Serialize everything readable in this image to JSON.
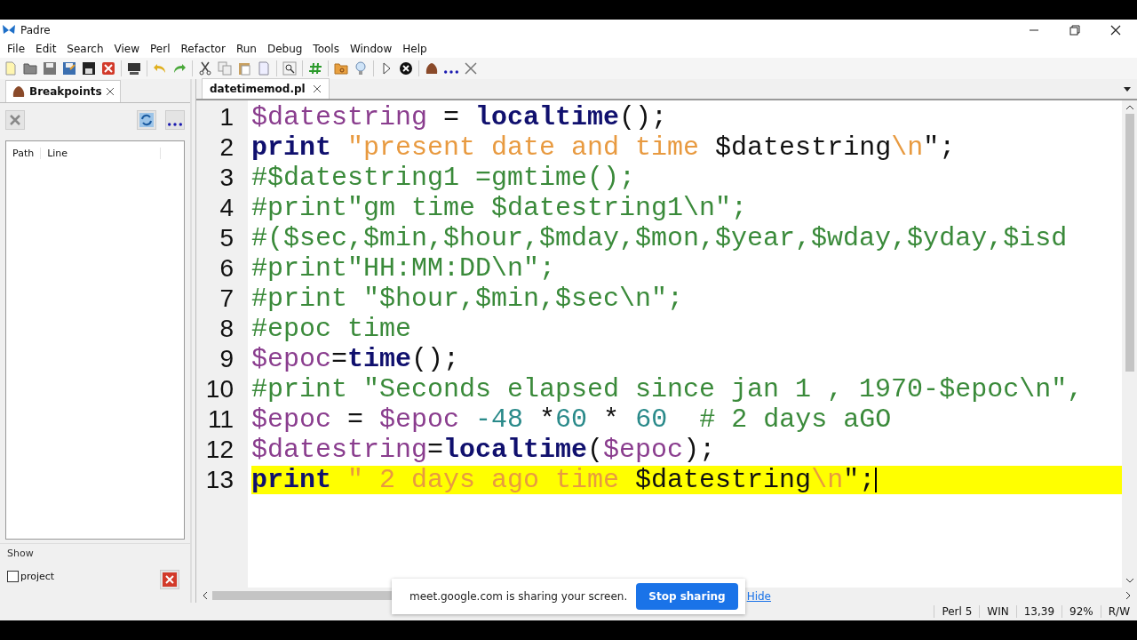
{
  "window": {
    "title": "Padre"
  },
  "menu": [
    "File",
    "Edit",
    "Search",
    "View",
    "Perl",
    "Refactor",
    "Run",
    "Debug",
    "Tools",
    "Window",
    "Help"
  ],
  "breakpoints_panel": {
    "tab": {
      "label": "Breakpoints",
      "selected": true
    },
    "columns": [
      "Path",
      "Line"
    ],
    "show_label": "Show",
    "project_checkbox": {
      "label": "project",
      "checked": false
    }
  },
  "editor": {
    "tabs": [
      {
        "label": "datetimemod.pl",
        "selected": true
      }
    ],
    "lines": [
      {
        "number": "1",
        "current": false,
        "tokens": [
          {
            "kind": "var",
            "text": "$datestring"
          },
          {
            "kind": "plain",
            "text": " = "
          },
          {
            "kind": "kw",
            "text": "localtime"
          },
          {
            "kind": "plain",
            "text": "();"
          }
        ]
      },
      {
        "number": "2",
        "current": false,
        "tokens": [
          {
            "kind": "kw",
            "text": "print "
          },
          {
            "kind": "str",
            "text": "\"present date and time "
          },
          {
            "kind": "plain",
            "text": "$datestring"
          },
          {
            "kind": "esc",
            "text": "\\n"
          },
          {
            "kind": "plain",
            "text": "\";"
          }
        ]
      },
      {
        "number": "3",
        "current": false,
        "tokens": [
          {
            "kind": "comment",
            "text": "#$datestring1 =gmtime();"
          }
        ]
      },
      {
        "number": "4",
        "current": false,
        "tokens": [
          {
            "kind": "comment",
            "text": "#print\"gm time $datestring1\\n\";"
          }
        ]
      },
      {
        "number": "5",
        "current": false,
        "tokens": [
          {
            "kind": "comment",
            "text": "#($sec,$min,$hour,$mday,$mon,$year,$wday,$yday,$isd"
          }
        ]
      },
      {
        "number": "6",
        "current": false,
        "tokens": [
          {
            "kind": "comment",
            "text": "#print\"HH:MM:DD\\n\";"
          }
        ]
      },
      {
        "number": "7",
        "current": false,
        "tokens": [
          {
            "kind": "comment",
            "text": "#print \"$hour,$min,$sec\\n\";"
          }
        ]
      },
      {
        "number": "8",
        "current": false,
        "tokens": [
          {
            "kind": "comment",
            "text": "#epoc time"
          }
        ]
      },
      {
        "number": "9",
        "current": false,
        "tokens": [
          {
            "kind": "var",
            "text": "$epoc"
          },
          {
            "kind": "plain",
            "text": "="
          },
          {
            "kind": "kw",
            "text": "time"
          },
          {
            "kind": "plain",
            "text": "();"
          }
        ]
      },
      {
        "number": "10",
        "current": false,
        "tokens": [
          {
            "kind": "comment",
            "text": "#print \"Seconds elapsed since jan 1 , 1970-$epoc\\n\","
          }
        ]
      },
      {
        "number": "11",
        "current": false,
        "tokens": [
          {
            "kind": "var",
            "text": "$epoc"
          },
          {
            "kind": "plain",
            "text": " = "
          },
          {
            "kind": "var",
            "text": "$epoc "
          },
          {
            "kind": "num",
            "text": "-48"
          },
          {
            "kind": "plain",
            "text": " *"
          },
          {
            "kind": "num",
            "text": "60"
          },
          {
            "kind": "plain",
            "text": " * "
          },
          {
            "kind": "num",
            "text": "60  "
          },
          {
            "kind": "comment",
            "text": "# 2 days aGO"
          }
        ]
      },
      {
        "number": "12",
        "current": false,
        "tokens": [
          {
            "kind": "var",
            "text": "$datestring"
          },
          {
            "kind": "plain",
            "text": "="
          },
          {
            "kind": "kw",
            "text": "localtime"
          },
          {
            "kind": "plain",
            "text": "("
          },
          {
            "kind": "var",
            "text": "$epoc"
          },
          {
            "kind": "plain",
            "text": ");"
          }
        ]
      },
      {
        "number": "13",
        "current": true,
        "tokens": [
          {
            "kind": "kw",
            "text": "print "
          },
          {
            "kind": "str",
            "text": "\" 2 days ago time "
          },
          {
            "kind": "plain",
            "text": "$datestring"
          },
          {
            "kind": "esc",
            "text": "\\n"
          },
          {
            "kind": "plain",
            "text": "\";"
          }
        ]
      }
    ]
  },
  "share_bar": {
    "message": "meet.google.com is sharing your screen.",
    "stop_button": "Stop sharing",
    "hide_link": "Hide"
  },
  "status_bar": [
    "Perl 5",
    "WIN",
    "13,39",
    "92%",
    "R/W"
  ]
}
